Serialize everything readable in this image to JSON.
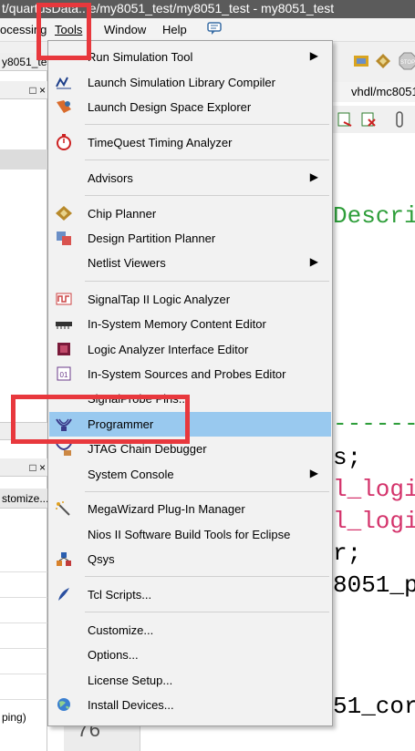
{
  "window": {
    "title": "t/quartusData...e/my8051_test/my8051_test - my8051_test"
  },
  "menubar": {
    "items": [
      {
        "label": "ocessing"
      },
      {
        "label": "Tools"
      },
      {
        "label": "Window"
      },
      {
        "label": "Help"
      }
    ]
  },
  "left_panel": {
    "tab_top": "y8051_tes",
    "header_icons": "□ ×",
    "mid_header_icons": "□ ×",
    "customize_label": "stomize...",
    "bottom_label": "ping)"
  },
  "editor": {
    "tab_label": "vhdl/mc8051",
    "code_lines": [
      {
        "text": "Descri",
        "color": "#2e9e3a"
      },
      {
        "text": "-------",
        "color": "#2e9e3a"
      },
      {
        "text": "s;",
        "color": "#000000"
      },
      {
        "text": "l_logi",
        "color": "#d4336b"
      },
      {
        "text": "l_logi",
        "color": "#d4336b"
      },
      {
        "text": "r;",
        "color": "#000000"
      },
      {
        "text": "8051_p",
        "color": "#000000"
      },
      {
        "text": "51_cor",
        "color": "#000000"
      }
    ],
    "line_number": "76"
  },
  "tools_menu": {
    "items": [
      {
        "label": "Run Simulation Tool",
        "icon": "simulation-icon",
        "submenu": true
      },
      {
        "label": "Launch Simulation Library Compiler",
        "icon": "library-compiler-icon"
      },
      {
        "label": "Launch Design Space Explorer",
        "icon": "design-space-icon"
      },
      {
        "label": "TimeQuest Timing Analyzer",
        "icon": "stopwatch-icon"
      },
      {
        "label": "Advisors",
        "icon": "",
        "submenu": true
      },
      {
        "label": "Chip Planner",
        "icon": "chip-planner-icon"
      },
      {
        "label": "Design Partition Planner",
        "icon": "partition-icon"
      },
      {
        "label": "Netlist Viewers",
        "icon": "",
        "submenu": true
      },
      {
        "label": "SignalTap II Logic Analyzer",
        "icon": "signaltap-icon"
      },
      {
        "label": "In-System Memory Content Editor",
        "icon": "memory-icon"
      },
      {
        "label": "Logic Analyzer Interface Editor",
        "icon": "logic-analyzer-icon"
      },
      {
        "label": "In-System Sources and Probes Editor",
        "icon": "sources-probes-icon"
      },
      {
        "label": "SignalProbe Pins...",
        "icon": ""
      },
      {
        "label": "Programmer",
        "icon": "programmer-icon"
      },
      {
        "label": "JTAG Chain Debugger",
        "icon": "jtag-icon"
      },
      {
        "label": "System Console",
        "icon": "",
        "submenu": true
      },
      {
        "label": "MegaWizard Plug-In Manager",
        "icon": "wand-icon"
      },
      {
        "label": "Nios II Software Build Tools for Eclipse",
        "icon": ""
      },
      {
        "label": "Qsys",
        "icon": "qsys-icon"
      },
      {
        "label": "Tcl Scripts...",
        "icon": "tcl-icon"
      },
      {
        "label": "Customize...",
        "icon": ""
      },
      {
        "label": "Options...",
        "icon": ""
      },
      {
        "label": "License Setup...",
        "icon": ""
      },
      {
        "label": "Install Devices...",
        "icon": "globe-icon"
      }
    ],
    "highlighted": "Programmer"
  },
  "colors": {
    "highlight": "#99c9ef",
    "annotation_red": "#e8383d"
  }
}
